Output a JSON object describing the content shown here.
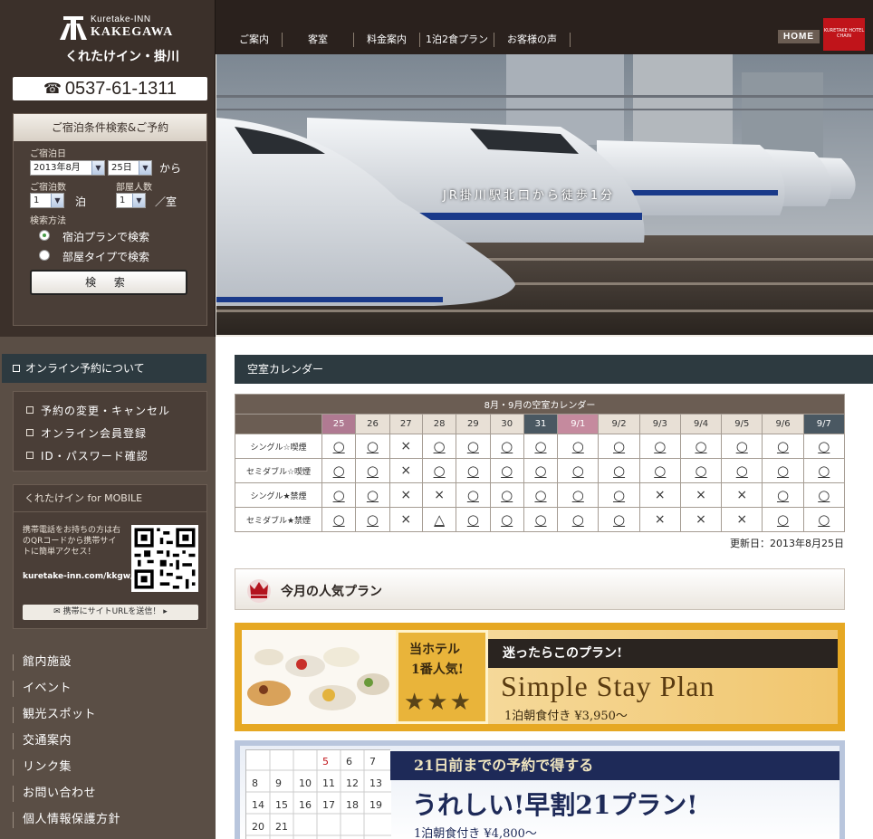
{
  "header": {
    "logo_en_small": "Kuretake-INN",
    "logo_en_large": "KAKEGAWA",
    "logo_jp": "くれたけイン・掛川",
    "phone": "0537-61-1311",
    "nav": [
      "ご案内",
      "客室",
      "料金案内",
      "1泊2食プラン",
      "お客様の声"
    ],
    "home_label": "HOME",
    "chain_logo": "KURETAKE HOTEL CHAIN"
  },
  "search": {
    "title": "ご宿泊条件検索&ご予約",
    "date_label": "ご宿泊日",
    "month_value": "2013年8月",
    "day_value": "25日",
    "from_label": "から",
    "nights_label": "ご宿泊数",
    "nights_value": "1",
    "nights_unit": "泊",
    "people_label": "部屋人数",
    "people_value": "1",
    "people_unit": "／室",
    "method_label": "検索方法",
    "method_plan": "宿泊プランで検索",
    "method_room": "部屋タイプで検索",
    "method_selected": "plan",
    "button": "検 索"
  },
  "hero": {
    "caption": "JR掛川駅北口から徒歩1分"
  },
  "sidebar": {
    "online_head": "オンライン予約について",
    "links": [
      "予約の変更・キャンセル",
      "オンライン会員登録",
      "ID・パスワード確認"
    ],
    "mobile_head": "くれたけイン for MOBILE",
    "mobile_text": "携帯電話をお持ちの方は右のQRコードから携帯サイトに簡単アクセス！",
    "mobile_url": "kuretake-inn.com/kkgw/m/",
    "send_button": "携帯にサイトURLを送信！",
    "text_links": [
      "館内施設",
      "イベント",
      "観光スポット",
      "交通案内",
      "リンク集",
      "お問い合わせ",
      "個人情報保護方針"
    ]
  },
  "calendar": {
    "section_title": "空室カレンダー",
    "table_title": "8月・9月の空室カレンダー",
    "dates": [
      "25",
      "26",
      "27",
      "28",
      "29",
      "30",
      "31",
      "9/1",
      "9/2",
      "9/3",
      "9/4",
      "9/5",
      "9/6",
      "9/7"
    ],
    "rows": [
      {
        "room": "シングル☆喫煙",
        "marks": [
          "○",
          "○",
          "×",
          "○",
          "○",
          "○",
          "○",
          "○",
          "○",
          "○",
          "○",
          "○",
          "○",
          "○"
        ]
      },
      {
        "room": "セミダブル☆喫煙",
        "marks": [
          "○",
          "○",
          "×",
          "○",
          "○",
          "○",
          "○",
          "○",
          "○",
          "○",
          "○",
          "○",
          "○",
          "○"
        ]
      },
      {
        "room": "シングル★禁煙",
        "marks": [
          "○",
          "○",
          "×",
          "×",
          "○",
          "○",
          "○",
          "○",
          "○",
          "×",
          "×",
          "×",
          "○",
          "○"
        ]
      },
      {
        "room": "セミダブル★禁煙",
        "marks": [
          "○",
          "○",
          "×",
          "△",
          "○",
          "○",
          "○",
          "○",
          "○",
          "×",
          "×",
          "×",
          "○",
          "○"
        ]
      }
    ],
    "updated": "更新日：2013年8月25日"
  },
  "popular": {
    "title": "今月の人気プラン"
  },
  "plan1": {
    "badge_line1": "当ホテル",
    "badge_line2": "1番人気!",
    "stars": "★★★",
    "banner": "迷ったらこのプラン!",
    "name": "Simple Stay Plan",
    "price": "1泊朝食付き ¥3,950〜"
  },
  "plan2": {
    "ribbon": "21日前までの予約で得する",
    "name": "うれしい!早割21プラン!",
    "price": "1泊朝食付き ¥4,800〜",
    "calendar_numbers": [
      "5",
      "6",
      "7",
      "8",
      "9",
      "10",
      "11",
      "12",
      "13",
      "14",
      "15",
      "16",
      "17",
      "18",
      "19",
      "20",
      "21"
    ]
  }
}
